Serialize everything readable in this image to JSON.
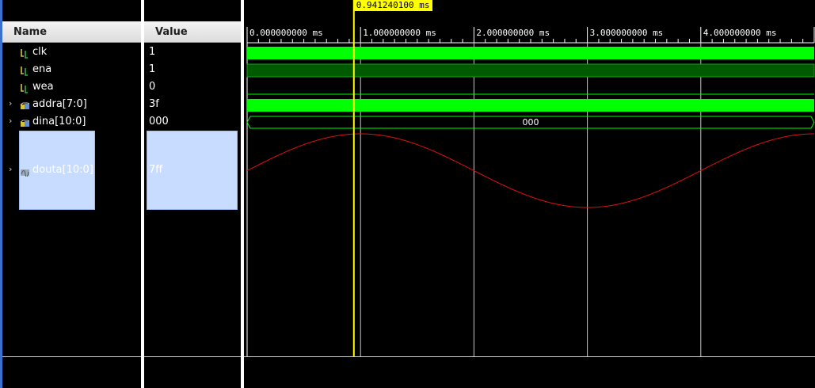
{
  "headers": {
    "name": "Name",
    "value": "Value"
  },
  "signals": [
    {
      "name": "clk",
      "value": "1",
      "kind": "bit",
      "expandable": false,
      "icon": "bit-signal-icon"
    },
    {
      "name": "ena",
      "value": "1",
      "kind": "bit",
      "expandable": false,
      "icon": "bit-signal-icon"
    },
    {
      "name": "wea",
      "value": "0",
      "kind": "bit",
      "expandable": false,
      "icon": "bit-signal-icon"
    },
    {
      "name": "addra[7:0]",
      "value": "3f",
      "kind": "bus",
      "expandable": true,
      "icon": "bus-signal-icon"
    },
    {
      "name": "dina[10:0]",
      "value": "000",
      "kind": "bus",
      "expandable": true,
      "icon": "bus-signal-icon"
    },
    {
      "name": "douta[10:0]",
      "value": "7ff",
      "kind": "analog",
      "expandable": true,
      "icon": "analog-signal-icon",
      "selected": true
    }
  ],
  "timeline": {
    "unit": "ms",
    "ticks": [
      "0.000000000 ms",
      "1.000000000 ms",
      "2.000000000 ms",
      "3.000000000 ms",
      "4.000000000 ms"
    ],
    "cursor_label": "0.941240100 ms",
    "cursor_time_ms": 0.9412401,
    "range_ms": [
      0,
      5.0
    ]
  },
  "waves": {
    "dina_value": "000",
    "douta_sine_period_ms": 4.0,
    "douta_peak_time_ms": 1.0
  },
  "colors": {
    "wave_green": "#00ff00",
    "wave_dark_green": "#005a00",
    "analog": "#e01010",
    "cursor": "#ffff00",
    "grid": "#c8c8c8"
  }
}
